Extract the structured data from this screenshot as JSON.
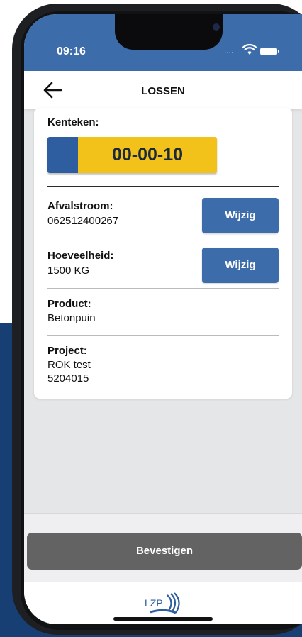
{
  "status_bar": {
    "time": "09:16",
    "signal": "....",
    "icons": [
      "wifi-icon",
      "battery-icon"
    ]
  },
  "header": {
    "title": "LOSSEN",
    "back_icon": "arrow-left-icon"
  },
  "kenteken": {
    "label": "Kenteken:",
    "plate": "00-00-10"
  },
  "afvalstroom": {
    "label": "Afvalstroom:",
    "value": "062512400267",
    "button": "Wijzig"
  },
  "hoeveelheid": {
    "label": "Hoeveelheid:",
    "value": "1500 KG",
    "button": "Wijzig"
  },
  "product": {
    "label": "Product:",
    "value": "Betonpuin"
  },
  "project": {
    "label": "Project:",
    "name": "ROK test",
    "number": "5204015"
  },
  "actions": {
    "confirm": "Bevestigen"
  },
  "footer": {
    "logo_text": "LZP"
  },
  "colors": {
    "brand_blue": "#3d6cab",
    "plate_yellow": "#f2c21b",
    "confirm_gray": "#636363",
    "background_blue": "#173f74"
  }
}
